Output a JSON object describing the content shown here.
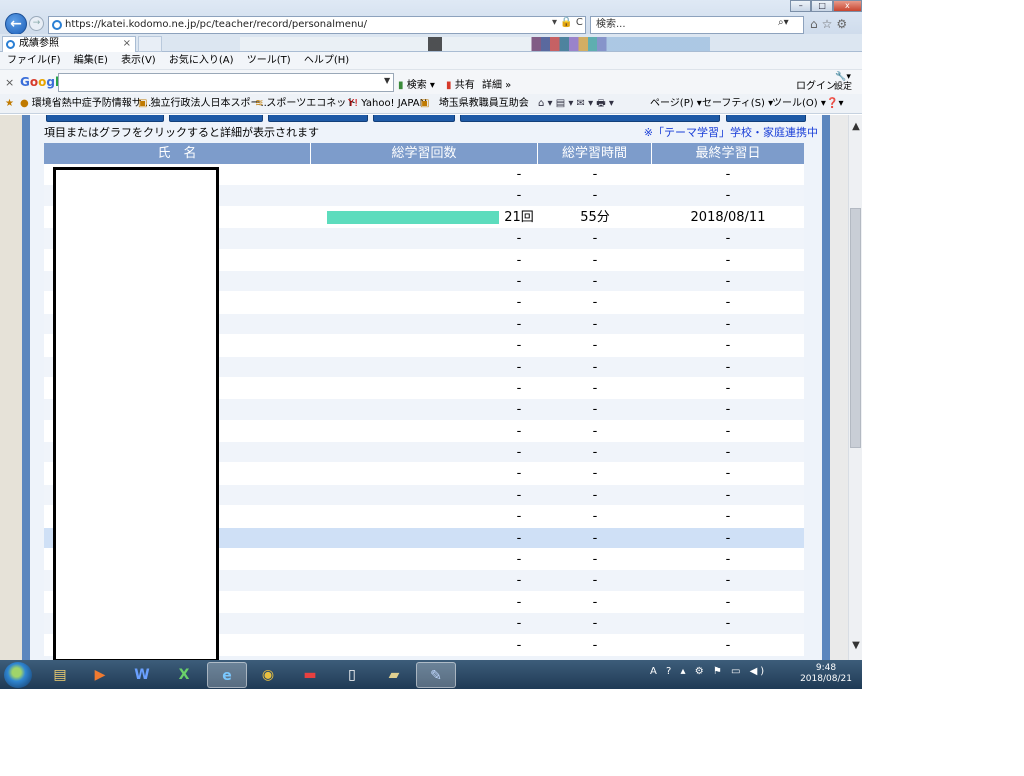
{
  "browser": {
    "url": "https://katei.kodomo.ne.jp/pc/teacher/record/personalmenu/",
    "url_tools": "▾ 🔒 C",
    "search_placeholder": "検索...",
    "tab_title": "成績参照",
    "tab_close": "×",
    "menu": [
      "ファイル(F)",
      "編集(E)",
      "表示(V)",
      "お気に入り(A)",
      "ツール(T)",
      "ヘルプ(H)"
    ],
    "google": {
      "logo": "Google",
      "search_label": "検索",
      "share_label": "共有",
      "more_label": "詳細 »",
      "login_label": "ログイン",
      "settings_label": "設定"
    },
    "favorites": [
      "環境省熱中症予防情報サ...",
      "独立行政法人日本スポー...",
      "スポーツエコネット",
      "Yahoo! JAPAN",
      "埼玉県教職員互助会"
    ],
    "command_items": [
      "ページ(P) ▾",
      "セーフティ(S) ▾",
      "ツール(O) ▾"
    ]
  },
  "page": {
    "hint": "項目またはグラフをクリックすると詳細が表示されます",
    "theme_note": "※「テーマ学習」学校・家庭連携中",
    "columns": [
      "氏　名",
      "総学習回数",
      "総学習時間",
      "最終学習日"
    ],
    "rows": [
      {
        "count_label": "-",
        "time": "-",
        "last_date": "-",
        "bar_fraction": 0,
        "selected": false
      },
      {
        "count_label": "-",
        "time": "-",
        "last_date": "-",
        "bar_fraction": 0,
        "selected": false
      },
      {
        "count_label": "21回",
        "time": "55分",
        "last_date": "2018/08/11",
        "bar_fraction": 1,
        "selected": false
      },
      {
        "count_label": "-",
        "time": "-",
        "last_date": "-",
        "bar_fraction": 0,
        "selected": false
      },
      {
        "count_label": "-",
        "time": "-",
        "last_date": "-",
        "bar_fraction": 0,
        "selected": false
      },
      {
        "count_label": "-",
        "time": "-",
        "last_date": "-",
        "bar_fraction": 0,
        "selected": false
      },
      {
        "count_label": "-",
        "time": "-",
        "last_date": "-",
        "bar_fraction": 0,
        "selected": false
      },
      {
        "count_label": "-",
        "time": "-",
        "last_date": "-",
        "bar_fraction": 0,
        "selected": false
      },
      {
        "count_label": "-",
        "time": "-",
        "last_date": "-",
        "bar_fraction": 0,
        "selected": false
      },
      {
        "count_label": "-",
        "time": "-",
        "last_date": "-",
        "bar_fraction": 0,
        "selected": false
      },
      {
        "count_label": "-",
        "time": "-",
        "last_date": "-",
        "bar_fraction": 0,
        "selected": false
      },
      {
        "count_label": "-",
        "time": "-",
        "last_date": "-",
        "bar_fraction": 0,
        "selected": false
      },
      {
        "count_label": "-",
        "time": "-",
        "last_date": "-",
        "bar_fraction": 0,
        "selected": false
      },
      {
        "count_label": "-",
        "time": "-",
        "last_date": "-",
        "bar_fraction": 0,
        "selected": false
      },
      {
        "count_label": "-",
        "time": "-",
        "last_date": "-",
        "bar_fraction": 0,
        "selected": false
      },
      {
        "count_label": "-",
        "time": "-",
        "last_date": "-",
        "bar_fraction": 0,
        "selected": false
      },
      {
        "count_label": "-",
        "time": "-",
        "last_date": "-",
        "bar_fraction": 0,
        "selected": false
      },
      {
        "count_label": "-",
        "time": "-",
        "last_date": "-",
        "bar_fraction": 0,
        "selected": true
      },
      {
        "count_label": "-",
        "time": "-",
        "last_date": "-",
        "bar_fraction": 0,
        "selected": false
      },
      {
        "count_label": "-",
        "time": "-",
        "last_date": "-",
        "bar_fraction": 0,
        "selected": false
      },
      {
        "count_label": "-",
        "time": "-",
        "last_date": "-",
        "bar_fraction": 0,
        "selected": false
      },
      {
        "count_label": "-",
        "time": "-",
        "last_date": "-",
        "bar_fraction": 0,
        "selected": false
      },
      {
        "count_label": "-",
        "time": "-",
        "last_date": "-",
        "bar_fraction": 0,
        "selected": false
      }
    ],
    "colors": {
      "header": "#7d9ccb",
      "bar": "#5ddcbd",
      "note": "#1a3fd8",
      "frame": "#5b86be"
    }
  },
  "taskbar": {
    "apps": [
      "explorer-icon",
      "media-player-icon",
      "word-icon",
      "excel-icon",
      "ie-icon",
      "chrome-icon",
      "app-red-icon",
      "notepad-icon",
      "folder-doc-icon",
      "paint-icon"
    ],
    "time": "9:48",
    "date": "2018/08/21"
  }
}
